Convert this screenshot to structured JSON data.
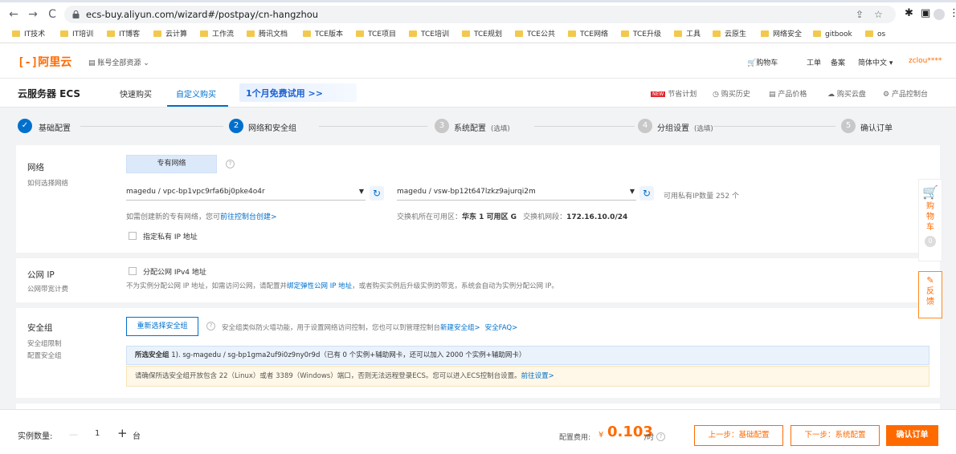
{
  "browser": {
    "url": "ecs-buy.aliyun.com/wizard#/postpay/cn-hangzhou",
    "bookmarks": [
      "IT技术",
      "IT培训",
      "IT博客",
      "云计算",
      "工作流",
      "腾讯文档",
      "TCE版本",
      "TCE项目",
      "TCE培训",
      "TCE规划",
      "TCE公共",
      "TCE网络",
      "TCE升级",
      "工具",
      "云原生",
      "网络安全",
      "gitbook",
      "os"
    ],
    "bookmark_color": "#f2c94c"
  },
  "topnav": {
    "logo": "阿里云",
    "account_selector": "账号全部资源",
    "cart": "购物车",
    "ticket": "工单",
    "filing": "备案",
    "language": "简体中文",
    "user": "zclou****"
  },
  "product": {
    "title": "云服务器 ECS",
    "tabs": [
      "快速购买",
      "自定义购买"
    ],
    "active_tab": "自定义购买",
    "promo": "1个月免费试用 >>",
    "new_badge": "NEW",
    "right_links": [
      "节省计划",
      "购买历史",
      "产品价格",
      "购买云盘",
      "产品控制台"
    ]
  },
  "steps": [
    {
      "num": "✓",
      "label": "基础配置",
      "optional": "",
      "state": "done"
    },
    {
      "num": "2",
      "label": "网络和安全组",
      "optional": "",
      "state": "active"
    },
    {
      "num": "3",
      "label": "系统配置",
      "optional": "(选填)",
      "state": "todo"
    },
    {
      "num": "4",
      "label": "分组设置",
      "optional": "(选填)",
      "state": "todo"
    },
    {
      "num": "5",
      "label": "确认订单",
      "optional": "",
      "state": "todo"
    }
  ],
  "network": {
    "title": "网络",
    "subtitle": "如何选择网络",
    "type_button": "专有网络",
    "vpc_value": "magedu / vpc-bp1vpc9rfa6bj0pke4o4r",
    "vswitch_value": "magedu / vsw-bp12t647lzkz9ajurqi2m",
    "available_ips": "可用私有IP数量 252 个",
    "vpc_hint_prefix": "如需创建新的专有网络，您可",
    "vpc_hint_link": "前往控制台创建>",
    "zone_label": "交换机所在可用区：",
    "zone_value": "华东 1 可用区 G",
    "cidr_label": "交换机网段：",
    "cidr_value": "172.16.10.0/24",
    "private_ip_checkbox": "指定私有 IP 地址"
  },
  "public_ip": {
    "title": "公网 IP",
    "subtitle": "公网带宽计费",
    "checkbox": "分配公网 IPv4 地址",
    "desc_prefix": "不为实例分配公网 IP 地址，如需访问公网，请配置并",
    "desc_link": "绑定弹性公网 IP 地址",
    "desc_suffix": "，或者购买实例后升级实例的带宽，系统会自动为实例分配公网 IP。"
  },
  "security_group": {
    "title": "安全组",
    "subtitle1": "安全组限制",
    "subtitle2": "配置安全组",
    "reselect_button": "重新选择安全组",
    "desc": "安全组类似防火墙功能，用于设置网络访问控制，您也可以到管理控制台",
    "link_new": "新建安全组>",
    "link_faq": "安全FAQ>",
    "selected_label": "所选安全组",
    "selected_value": "1). sg-magedu / sg-bp1gma2uf9i0z9ny0r9d（已有 0 个实例+辅助网卡，还可以加入 2000 个实例+辅助网卡）",
    "warning": "请确保所选安全组开放包含 22（Linux）或者 3389（Windows）端口，否则无法远程登录ECS。您可以进入ECS控制台设置。",
    "warning_link": "前往设置>"
  },
  "side": {
    "cart_label": "购物车",
    "cart_count": "0",
    "feedback_label": "反馈"
  },
  "footer": {
    "qty_label": "实例数量:",
    "qty_minus": "—",
    "qty_value": "1",
    "qty_plus": "+",
    "qty_unit": "台",
    "price_label": "配置费用:",
    "price_currency": "¥",
    "price_value": "0.103",
    "price_unit": "/时",
    "prev_button": "上一步：基础配置",
    "next_button": "下一步：系统配置",
    "confirm_button": "确认订单"
  },
  "colors": {
    "brand_orange": "#ff6a00",
    "link_blue": "#0070cc",
    "step_done": "#0070cc",
    "step_active": "#0070cc",
    "step_todo": "#c8c8c8"
  }
}
